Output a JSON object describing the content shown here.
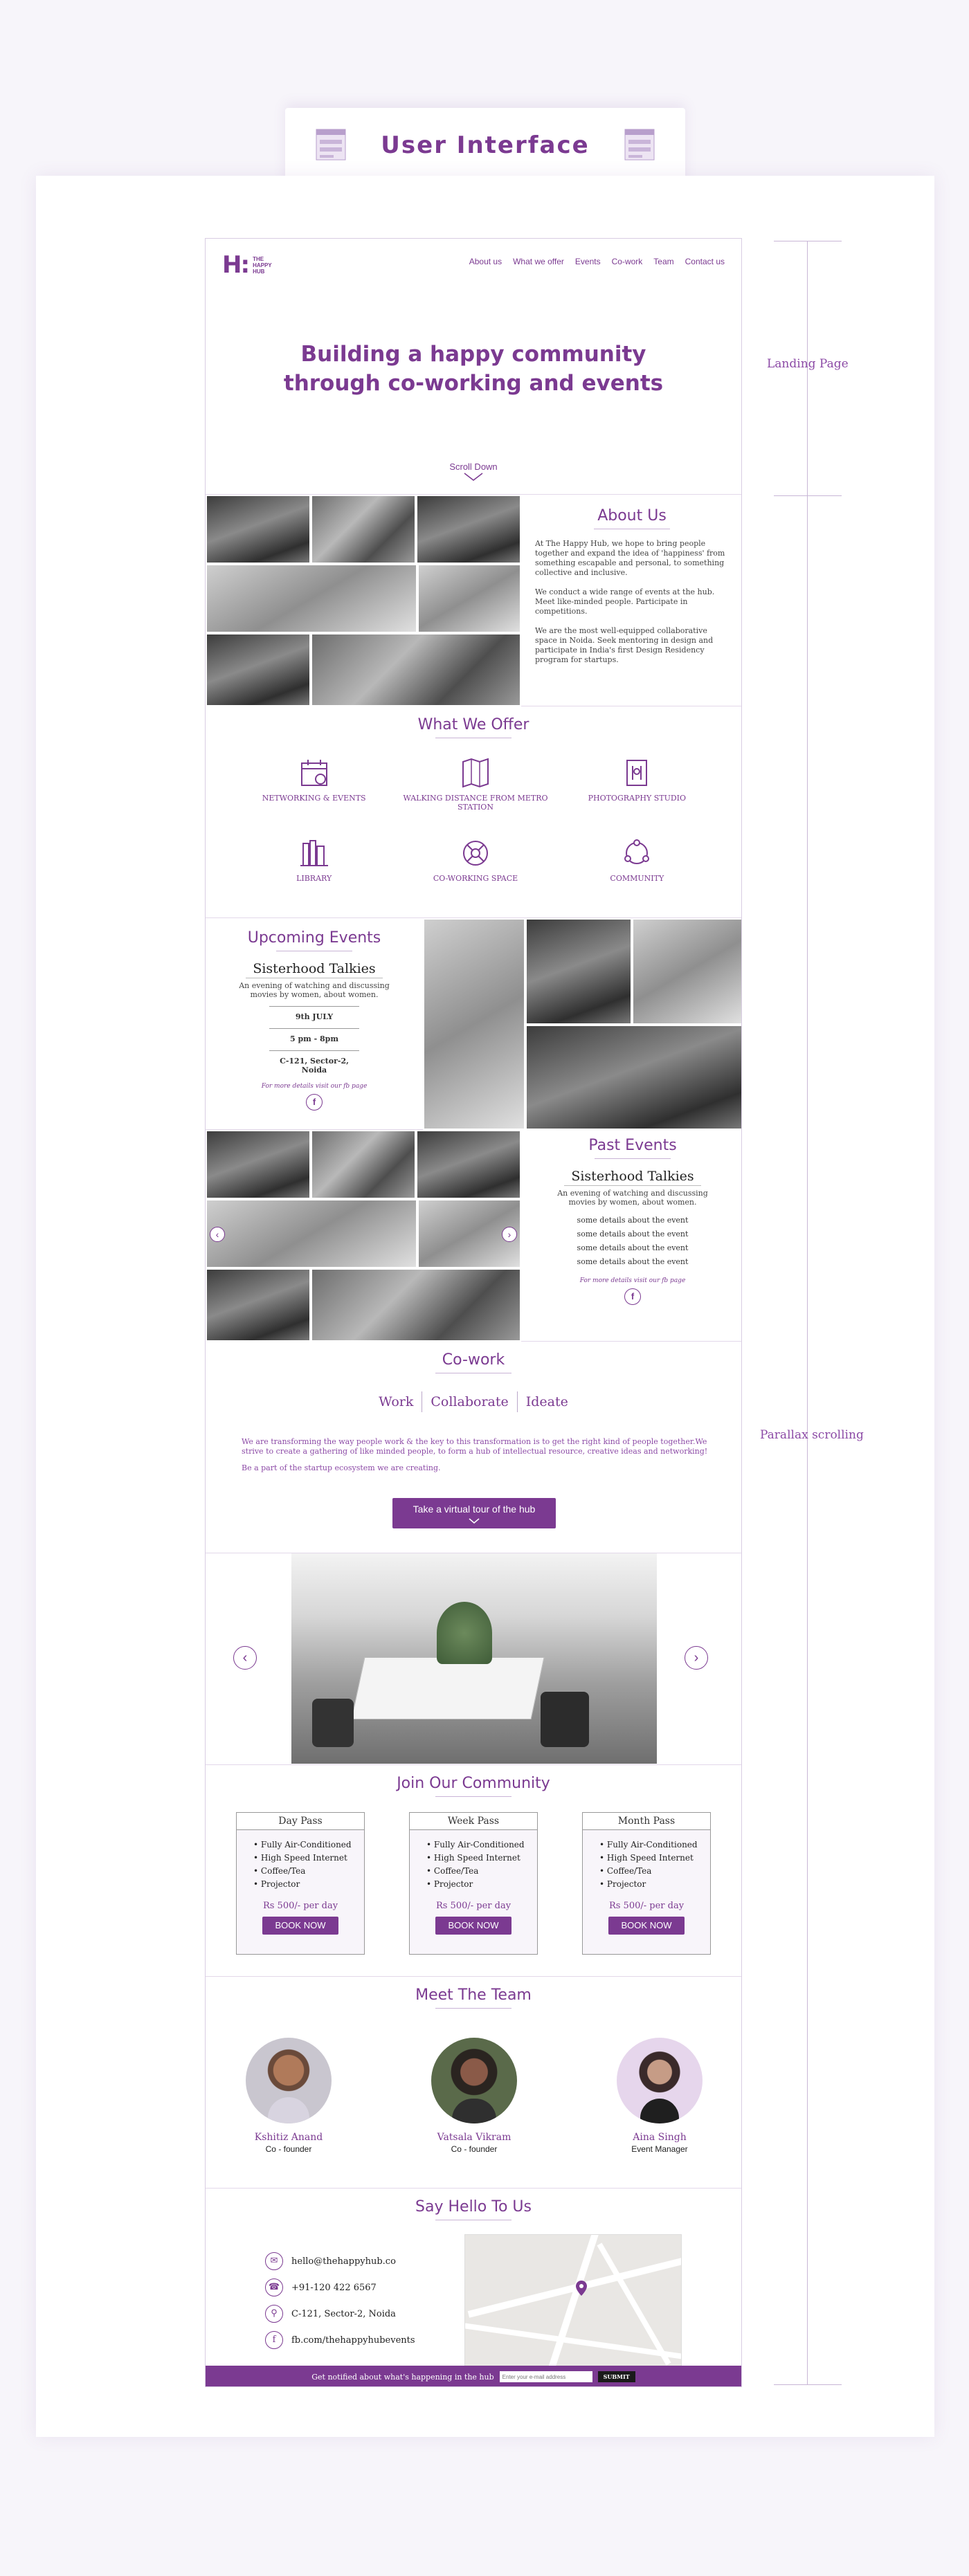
{
  "board": {
    "title": "User Interface",
    "labels": {
      "landing": "Landing Page",
      "parallax": "Parallax scrolling"
    },
    "accent": "#7b3a91"
  },
  "site": {
    "logo": {
      "mark": "H:",
      "words": [
        "THE",
        "HAPPY",
        "HUB"
      ]
    },
    "nav": [
      "About us",
      "What we offer",
      "Events",
      "Co-work",
      "Team",
      "Contact us"
    ],
    "hero": {
      "line1": "Building a happy community",
      "line2": "through co-working and events",
      "scroll": "Scroll Down"
    },
    "about": {
      "heading": "About Us",
      "p1": "At The Happy Hub, we hope to bring people together and expand the idea of 'happiness' from something escapable and personal, to something collective and inclusive.",
      "p2": "We conduct a wide range of events at the hub. Meet like-minded people. Participate in competitions.",
      "p3": "We are the most well-equipped collaborative space in Noida. Seek mentoring in design and participate in India's first Design Residency program for startups."
    },
    "offer": {
      "heading": "What We Offer",
      "items": [
        {
          "label": "NETWORKING & EVENTS",
          "icon": "calendar-icon"
        },
        {
          "label": "WALKING DISTANCE FROM METRO STATION",
          "icon": "map-icon"
        },
        {
          "label": "PHOTOGRAPHY STUDIO",
          "icon": "camera-icon"
        },
        {
          "label": "LIBRARY",
          "icon": "books-icon"
        },
        {
          "label": "CO-WORKING SPACE",
          "icon": "coworking-icon"
        },
        {
          "label": "COMMUNITY",
          "icon": "community-icon"
        }
      ]
    },
    "upcoming": {
      "heading": "Upcoming Events",
      "name": "Sisterhood Talkies",
      "desc": "An evening of watching and discussing movies by women, about women.",
      "date": "9th JULY",
      "time": "5 pm - 8pm",
      "place": "C-121, Sector-2, Noida",
      "more": "For more details visit our fb page"
    },
    "past": {
      "heading": "Past Events",
      "name": "Sisterhood Talkies",
      "desc": "An evening of watching and discussing movies by women, about women.",
      "details": [
        "some details about the event",
        "some details about the event",
        "some details about the event",
        "some details about the event"
      ],
      "more": "For more details visit our fb page"
    },
    "cowork": {
      "heading": "Co-work",
      "tabs": [
        "Work",
        "Collaborate",
        "Ideate"
      ],
      "text1": "We are transforming the way people work & the key to this transformation is to get the right kind of people together.We strive to create a gathering of like minded people, to form a hub of intellectual resource, creative ideas and networking!",
      "text2": "Be a part of the startup ecosystem we are creating.",
      "tour": "Take a virtual tour of  the hub"
    },
    "join": {
      "heading": "Join Our Community",
      "plans": [
        {
          "name": "Day Pass",
          "features": [
            "Fully Air-Conditioned",
            "High Speed Internet",
            "Coffee/Tea",
            "Projector"
          ],
          "price": "Rs 500/- per day",
          "cta": "BOOK  NOW"
        },
        {
          "name": "Week Pass",
          "features": [
            "Fully Air-Conditioned",
            "High Speed Internet",
            "Coffee/Tea",
            "Projector"
          ],
          "price": "Rs 500/- per day",
          "cta": "BOOK  NOW"
        },
        {
          "name": "Month Pass",
          "features": [
            "Fully Air-Conditioned",
            "High Speed Internet",
            "Coffee/Tea",
            "Projector"
          ],
          "price": "Rs 500/- per day",
          "cta": "BOOK  NOW"
        }
      ]
    },
    "team": {
      "heading": "Meet The Team",
      "members": [
        {
          "name": "Kshitiz Anand",
          "role": "Co - founder"
        },
        {
          "name": "Vatsala Vikram",
          "role": "Co - founder"
        },
        {
          "name": "Aina Singh",
          "role": "Event Manager"
        }
      ]
    },
    "contact": {
      "heading": "Say Hello To Us",
      "email": "hello@thehappyhub.co",
      "phone": "+91-120 422 6567",
      "address": "C-121, Sector-2, Noida",
      "fb": "fb.com/thehappyhubevents"
    },
    "footer": {
      "text": "Get notified about what's happening in the hub",
      "placeholder": "Enter your e-mail address",
      "submit": "SUBMIT"
    }
  }
}
